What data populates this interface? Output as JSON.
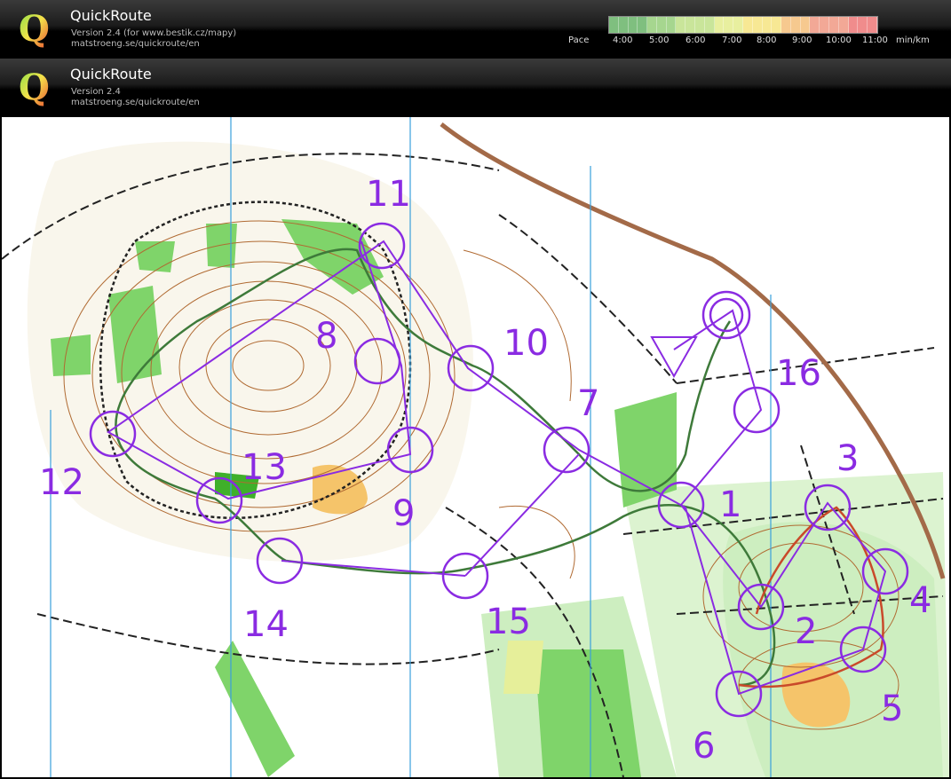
{
  "header_top": {
    "title": "QuickRoute",
    "version": "Version 2.4  (for www.bestik.cz/mapy)",
    "site": "matstroeng.se/quickroute/en",
    "pace_label": "Pace",
    "pace_ticks": [
      "4:00",
      "5:00",
      "6:00",
      "7:00",
      "8:00",
      "9:00",
      "10:00",
      "11:00",
      "min/km"
    ]
  },
  "header_second": {
    "title": "QuickRoute",
    "version": "Version 2.4",
    "site": "matstroeng.se/quickroute/en"
  },
  "pace_scale": {
    "min": "4:00",
    "max": "11:00",
    "colors": [
      "#7fbf7f",
      "#a6d68f",
      "#c9e59a",
      "#e8ef9f",
      "#f7e894",
      "#f6c98f",
      "#f2a896",
      "#f08c8c"
    ]
  },
  "map": {
    "controls": [
      {
        "label": "1"
      },
      {
        "label": "2"
      },
      {
        "label": "3"
      },
      {
        "label": "4"
      },
      {
        "label": "5"
      },
      {
        "label": "6"
      },
      {
        "label": "7"
      },
      {
        "label": "8"
      },
      {
        "label": "9"
      },
      {
        "label": "10"
      },
      {
        "label": "11"
      },
      {
        "label": "12"
      },
      {
        "label": "13"
      },
      {
        "label": "14"
      },
      {
        "label": "15"
      },
      {
        "label": "16"
      }
    ],
    "colors": {
      "course": "#8a2be2",
      "forest_green": "#7fd46a",
      "light_green": "#cdeec0",
      "contour": "#b06a32",
      "track": "#222222",
      "north_lines": "#3aa0dc",
      "open_land": "#f5c46a"
    }
  }
}
